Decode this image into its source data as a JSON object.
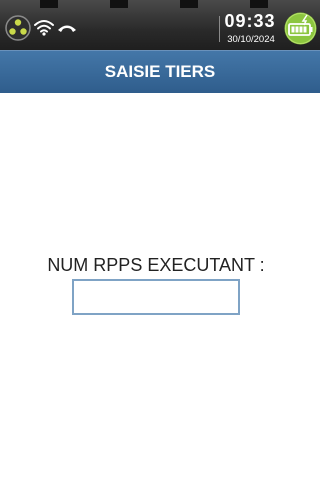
{
  "status_bar": {
    "time": "09:33",
    "date": "30/10/2024",
    "icons": [
      "connection-icon",
      "wifi-icon",
      "phone-hangup-icon",
      "battery-charging-icon"
    ],
    "battery_color": "#8cc63f"
  },
  "header": {
    "title": "SAISIE TIERS",
    "color": "#3a6a9a"
  },
  "form": {
    "field_label": "NUM RPPS EXECUTANT :",
    "field_value": "",
    "border_color": "#7fa3c5"
  }
}
